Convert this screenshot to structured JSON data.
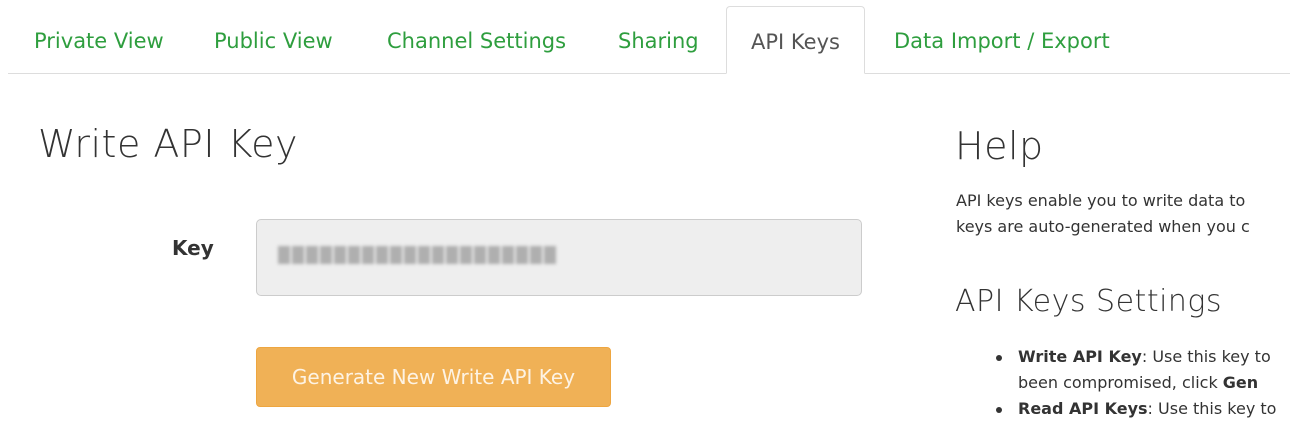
{
  "tabs": [
    {
      "label": "Private View",
      "active": false
    },
    {
      "label": "Public View",
      "active": false
    },
    {
      "label": "Channel Settings",
      "active": false
    },
    {
      "label": "Sharing",
      "active": false
    },
    {
      "label": "API Keys",
      "active": true
    },
    {
      "label": "Data Import / Export",
      "active": false
    }
  ],
  "main": {
    "heading": "Write API Key",
    "key_label": "Key",
    "generate_button": "Generate New Write API Key"
  },
  "help": {
    "heading": "Help",
    "paragraph_line1": "API keys enable you to write data to",
    "paragraph_line2": "keys are auto-generated when you c",
    "settings_heading": "API Keys Settings",
    "items": [
      {
        "title": "Write API Key",
        "line1": ": Use this key to",
        "line2_prefix": "been compromised, click ",
        "line2_bold": "Gen"
      },
      {
        "title": "Read API Keys",
        "line1": ": Use this key to",
        "line2_prefix": "",
        "line2_bold": ""
      }
    ]
  },
  "colors": {
    "tab_link": "#2e9e3e",
    "tab_active": "#555555",
    "warning_button": "#f0ad4e"
  }
}
